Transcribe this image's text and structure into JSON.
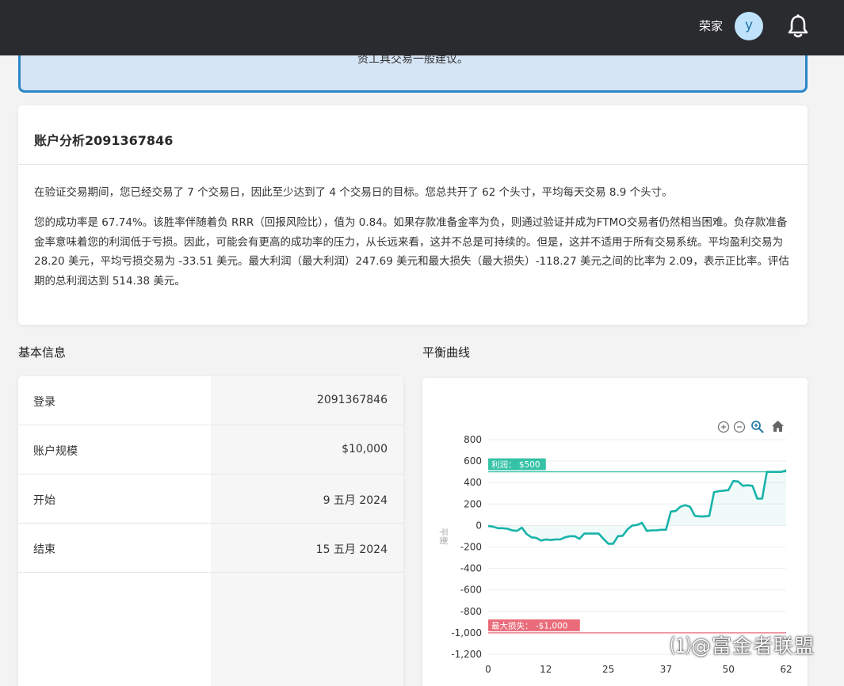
{
  "header": {
    "user_name": "荣家",
    "avatar_initial": "y",
    "bell_icon": "bell-icon"
  },
  "notice": {
    "text": "资工具交易一般建议。"
  },
  "analysis": {
    "title": "账户分析2091367846",
    "paragraph1": "在验证交易期间，您已经交易了 7 个交易日，因此至少达到了 4 个交易日的目标。您总共开了 62 个头寸，平均每天交易 8.9 个头寸。",
    "paragraph2": "您的成功率是 67.74%。该胜率伴随着负 RRR（回报风险比），值为 0.84。如果存款准备金率为负，则通过验证并成为FTMO交易者仍然相当困难。负存款准备金率意味着您的利润低于亏损。因此，可能会有更高的成功率的压力，从长远来看，这并不总是可持续的。但是，这并不适用于所有交易系统。平均盈利交易为 28.20 美元，平均亏损交易为 -33.51 美元。最大利润（最大利润）247.69 美元和最大损失（最大损失）-118.27 美元之间的比率为 2.09，表示正比率。评估期的总利润达到 514.38 美元。"
  },
  "basic_info": {
    "title": "基本信息",
    "rows": [
      {
        "label": "登录",
        "value": "2091367846"
      },
      {
        "label": "账户规模",
        "value": "$10,000"
      },
      {
        "label": "开始",
        "value": "9 五月 2024"
      },
      {
        "label": "结束",
        "value": "15 五月 2024"
      }
    ]
  },
  "balance_curve": {
    "title": "平衡曲线",
    "toolbar": [
      "zoom-in-icon",
      "zoom-out-icon",
      "zoom-select-icon",
      "home-icon"
    ]
  },
  "chart_data": {
    "type": "area",
    "ylabel": "平衡",
    "ylim": [
      -1200,
      800
    ],
    "xlim": [
      0,
      62
    ],
    "y_ticks": [
      "800",
      "600",
      "400",
      "200",
      "0",
      "-200",
      "-400",
      "-600",
      "-800",
      "-1,000",
      "-1,200"
    ],
    "x_ticks": [
      "0",
      "12",
      "25",
      "37",
      "50",
      "62"
    ],
    "annotations": [
      {
        "label": "利润： $500",
        "y": 500,
        "color": "#36c2a6"
      },
      {
        "label": "最大损失： -$1,000",
        "y": -1000,
        "color": "#ea6c7a"
      }
    ],
    "series": [
      {
        "line_color": "#17b3aa",
        "x": [
          0,
          1,
          2,
          3,
          4,
          5,
          6,
          7,
          8,
          9,
          10,
          11,
          12,
          13,
          14,
          15,
          16,
          17,
          18,
          19,
          20,
          21,
          22,
          23,
          24,
          25,
          26,
          27,
          28,
          29,
          30,
          31,
          32,
          33,
          34,
          35,
          36,
          37,
          38,
          39,
          40,
          41,
          42,
          43,
          44,
          45,
          46,
          47,
          48,
          49,
          50,
          51,
          52,
          53,
          54,
          55,
          56,
          57,
          58,
          59,
          60,
          61,
          62
        ],
        "y": [
          -5,
          -10,
          -25,
          -25,
          -30,
          -45,
          -50,
          -20,
          -80,
          -110,
          -115,
          -140,
          -130,
          -135,
          -130,
          -130,
          -110,
          -100,
          -100,
          -125,
          -75,
          -75,
          -75,
          -75,
          -125,
          -170,
          -170,
          -100,
          -95,
          -35,
          0,
          5,
          25,
          -50,
          -45,
          -45,
          -40,
          -40,
          130,
          135,
          175,
          190,
          175,
          90,
          85,
          85,
          90,
          310,
          320,
          325,
          330,
          415,
          410,
          370,
          375,
          370,
          250,
          250,
          500,
          500,
          500,
          500,
          514
        ]
      }
    ]
  },
  "watermark": "⑴@富金者联盟"
}
